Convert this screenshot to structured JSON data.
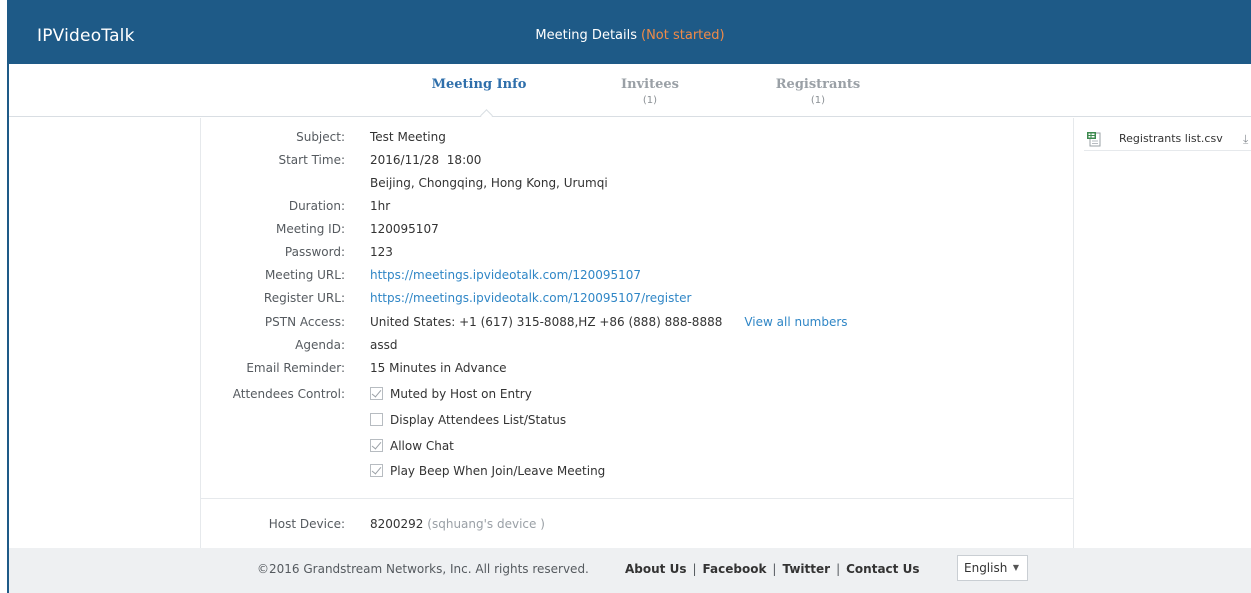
{
  "header": {
    "brand": "IPVideoTalk",
    "title": "Meeting Details",
    "status": "(Not started)"
  },
  "tabs": [
    {
      "label": "Meeting Info",
      "count": ""
    },
    {
      "label": "Invitees",
      "count": "(1)"
    },
    {
      "label": "Registrants",
      "count": "(1)"
    }
  ],
  "details": {
    "subject": {
      "label": "Subject:",
      "value": "Test Meeting"
    },
    "start_time": {
      "label": "Start Time:",
      "value": "2016/11/28  18:00",
      "timezone": "Beijing, Chongqing, Hong Kong, Urumqi"
    },
    "duration": {
      "label": "Duration:",
      "value": "1hr"
    },
    "meeting_id": {
      "label": "Meeting ID:",
      "value": "120095107"
    },
    "password": {
      "label": "Password:",
      "value": "123"
    },
    "meeting_url": {
      "label": "Meeting URL:",
      "value": "https://meetings.ipvideotalk.com/120095107"
    },
    "register_url": {
      "label": "Register URL:",
      "value": "https://meetings.ipvideotalk.com/120095107/register"
    },
    "pstn_access": {
      "label": "PSTN Access:",
      "value": "United States: +1 (617) 315-8088,HZ +86 (888) 888-8888",
      "link": "View all numbers"
    },
    "agenda": {
      "label": "Agenda:",
      "value": "assd"
    },
    "email_reminder": {
      "label": "Email Reminder:",
      "value": "15 Minutes in Advance"
    },
    "attendees_control": {
      "label": "Attendees Control:",
      "options": [
        {
          "label": "Muted by Host on Entry",
          "checked": true
        },
        {
          "label": "Display Attendees List/Status",
          "checked": false
        },
        {
          "label": "Allow Chat",
          "checked": true
        },
        {
          "label": "Play Beep When Join/Leave Meeting",
          "checked": true
        }
      ]
    },
    "host_device": {
      "label": "Host Device:",
      "value": "8200292",
      "owner": "(sqhuang's device )"
    }
  },
  "side_panel": {
    "file_name": "Registrants list.csv",
    "file_icon": "csv-file-icon",
    "download_icon": "download-icon"
  },
  "footer": {
    "copyright": "©2016 Grandstream Networks, Inc. All rights reserved.",
    "links": [
      "About Us",
      "Facebook",
      "Twitter",
      "Contact Us"
    ],
    "language": "English"
  }
}
